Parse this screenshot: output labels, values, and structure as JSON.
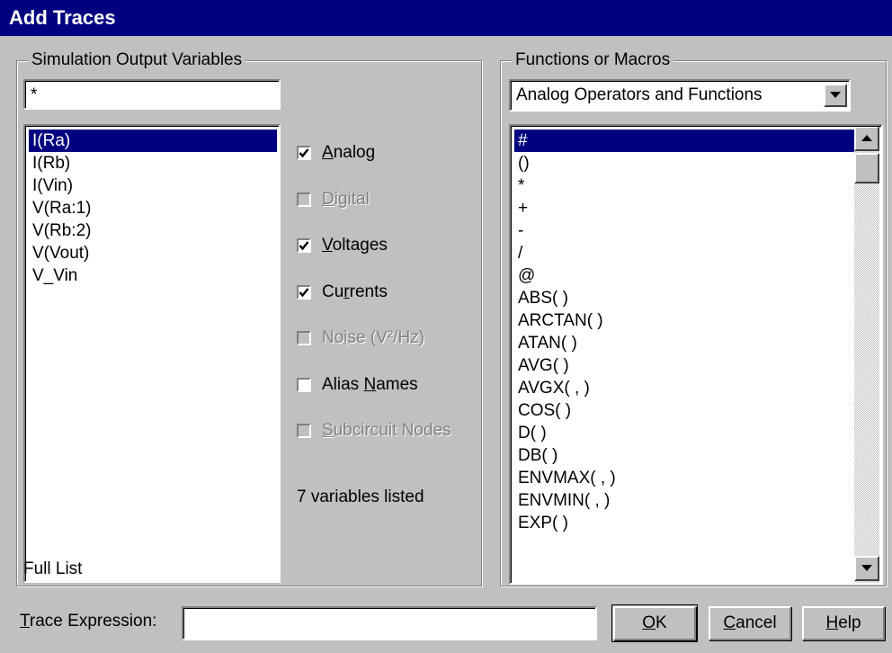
{
  "window": {
    "title": "Add Traces"
  },
  "sim_vars": {
    "group_label": "Simulation Output Variables",
    "filter_value": "*",
    "items": [
      "I(Ra)",
      "I(Rb)",
      "I(Vin)",
      "V(Ra:1)",
      "V(Rb:2)",
      "V(Vout)",
      "V_Vin"
    ],
    "selected_index": 0,
    "footer": "Full List"
  },
  "options": [
    {
      "key": "analog",
      "pre": "",
      "accel": "A",
      "post": "nalog",
      "checked": true,
      "enabled": true
    },
    {
      "key": "digital",
      "pre": "",
      "accel": "D",
      "post": "igital",
      "checked": false,
      "enabled": false
    },
    {
      "key": "voltages",
      "pre": "",
      "accel": "V",
      "post": "oltages",
      "checked": true,
      "enabled": true
    },
    {
      "key": "currents",
      "pre": "Cu",
      "accel": "r",
      "post": "rents",
      "checked": true,
      "enabled": true
    },
    {
      "key": "noise",
      "pre": "No",
      "accel": "i",
      "post": "se (V²/Hz)",
      "checked": false,
      "enabled": false
    },
    {
      "key": "alias-names",
      "pre": "Alias ",
      "accel": "N",
      "post": "ames",
      "checked": false,
      "enabled": true
    },
    {
      "key": "subcircuit-nodes",
      "pre": "",
      "accel": "S",
      "post": "ubcircuit Nodes",
      "checked": false,
      "enabled": false
    }
  ],
  "status": {
    "count_text": "7 variables listed"
  },
  "functions": {
    "group_label": "Functions or Macros",
    "dropdown_value": "Analog Operators and Functions",
    "items": [
      "#",
      "()",
      "*",
      "+",
      "-",
      "/",
      "@",
      "ABS( )",
      "ARCTAN( )",
      "ATAN( )",
      "AVG( )",
      "AVGX( , )",
      "COS( )",
      "D( )",
      "DB( )",
      "ENVMAX( , )",
      "ENVMIN( , )",
      "EXP( )"
    ],
    "selected_index": 0
  },
  "trace": {
    "label_accel": "T",
    "label_rest": "race Expression:",
    "value": ""
  },
  "buttons": {
    "ok": {
      "accel": "O",
      "rest": "K"
    },
    "cancel": {
      "accel": "C",
      "rest": "ancel"
    },
    "help": {
      "accel": "H",
      "rest": "elp"
    }
  },
  "icons": {
    "check": "check-mark-icon",
    "dropdown": "triangle-down-icon",
    "scroll_up": "triangle-up-icon",
    "scroll_down": "triangle-down-icon"
  },
  "colors": {
    "title_bar": "#000080",
    "selection": "#000080",
    "face": "#c0c0c0"
  }
}
